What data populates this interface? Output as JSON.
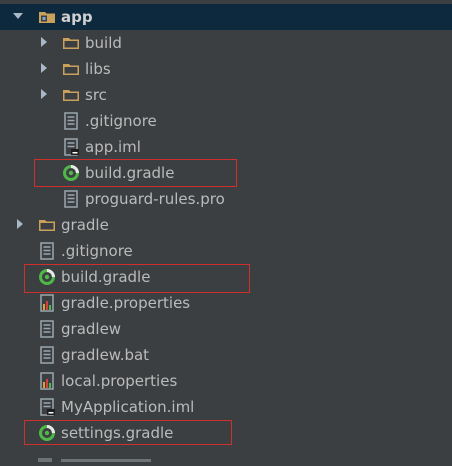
{
  "tree": {
    "root": {
      "label": "app",
      "icon": "module-folder-icon",
      "expanded": true
    },
    "app_children": [
      {
        "label": "build",
        "icon": "folder-icon"
      },
      {
        "label": "libs",
        "icon": "folder-icon"
      },
      {
        "label": "src",
        "icon": "folder-icon"
      },
      {
        "label": ".gitignore",
        "icon": "file-icon"
      },
      {
        "label": "app.iml",
        "icon": "iml-file-icon"
      },
      {
        "label": "build.gradle",
        "icon": "gradle-icon",
        "highlighted": true
      },
      {
        "label": "proguard-rules.pro",
        "icon": "file-icon"
      }
    ],
    "top_level": [
      {
        "label": "gradle",
        "icon": "folder-icon"
      },
      {
        "label": ".gitignore",
        "icon": "file-icon"
      },
      {
        "label": "build.gradle",
        "icon": "gradle-icon",
        "highlighted": true
      },
      {
        "label": "gradle.properties",
        "icon": "properties-file-icon"
      },
      {
        "label": "gradlew",
        "icon": "file-icon"
      },
      {
        "label": "gradlew.bat",
        "icon": "file-icon"
      },
      {
        "label": "local.properties",
        "icon": "properties-file-icon"
      },
      {
        "label": "MyApplication.iml",
        "icon": "iml-file-icon"
      },
      {
        "label": "settings.gradle",
        "icon": "gradle-icon",
        "highlighted": true
      }
    ]
  },
  "colors": {
    "background": "#3c3f41",
    "selection": "#0d293e",
    "text": "#bbbbbb",
    "folder": "#c9a15b",
    "gradle": "#4fb848",
    "highlight_box": "#d0302b"
  }
}
